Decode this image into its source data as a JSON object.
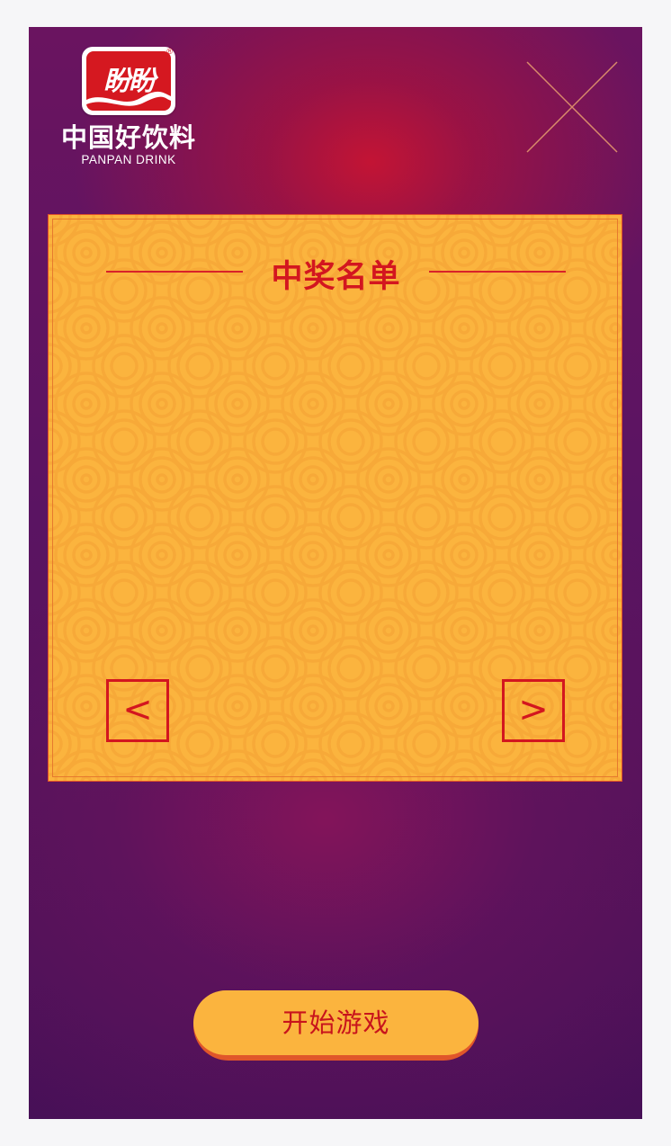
{
  "brand": {
    "badge_text": "盼盼",
    "registered_mark": "®",
    "slogan_cn": "中国好饮料",
    "slogan_en": "PANPAN DRINK"
  },
  "close": {
    "icon": "close-icon"
  },
  "panel": {
    "title": "中奖名单",
    "prev_label": "<",
    "next_label": ">",
    "winners": []
  },
  "start_button": {
    "label": "开始游戏"
  },
  "colors": {
    "background_top": "#6a1460",
    "background_glow": "#c81432",
    "background_bottom": "#471057",
    "panel": "#fbb43e",
    "accent_red": "#d3161f",
    "button_shadow": "#e0562a"
  }
}
